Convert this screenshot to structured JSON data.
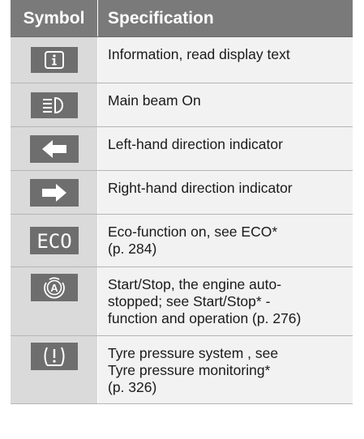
{
  "header": {
    "symbol": "Symbol",
    "specification": "Specification"
  },
  "rows": [
    {
      "icon": "information-icon",
      "text": "Information, read display text"
    },
    {
      "icon": "main-beam-icon",
      "text": "Main beam On"
    },
    {
      "icon": "left-arrow-icon",
      "text": "Left-hand direction indicator"
    },
    {
      "icon": "right-arrow-icon",
      "text": "Right-hand direction indicator"
    },
    {
      "icon": "eco-icon",
      "icon_text": "ECO",
      "text_lines": [
        "Eco-function on, see ECO*",
        "(p. 284)"
      ]
    },
    {
      "icon": "start-stop-icon",
      "text_lines": [
        "Start/Stop, the engine auto-",
        "stopped; see Start/Stop* -",
        "function and operation (p. 276)"
      ]
    },
    {
      "icon": "tyre-pressure-icon",
      "text_lines": [
        "Tyre pressure system , see",
        "Tyre pressure monitoring*",
        "(p. 326)"
      ]
    }
  ],
  "colors": {
    "header_bg": "#7a7a7a",
    "symbol_bg": "#dadada",
    "spec_bg": "#f2f2f2",
    "icon_bg": "#6e6e6e"
  }
}
